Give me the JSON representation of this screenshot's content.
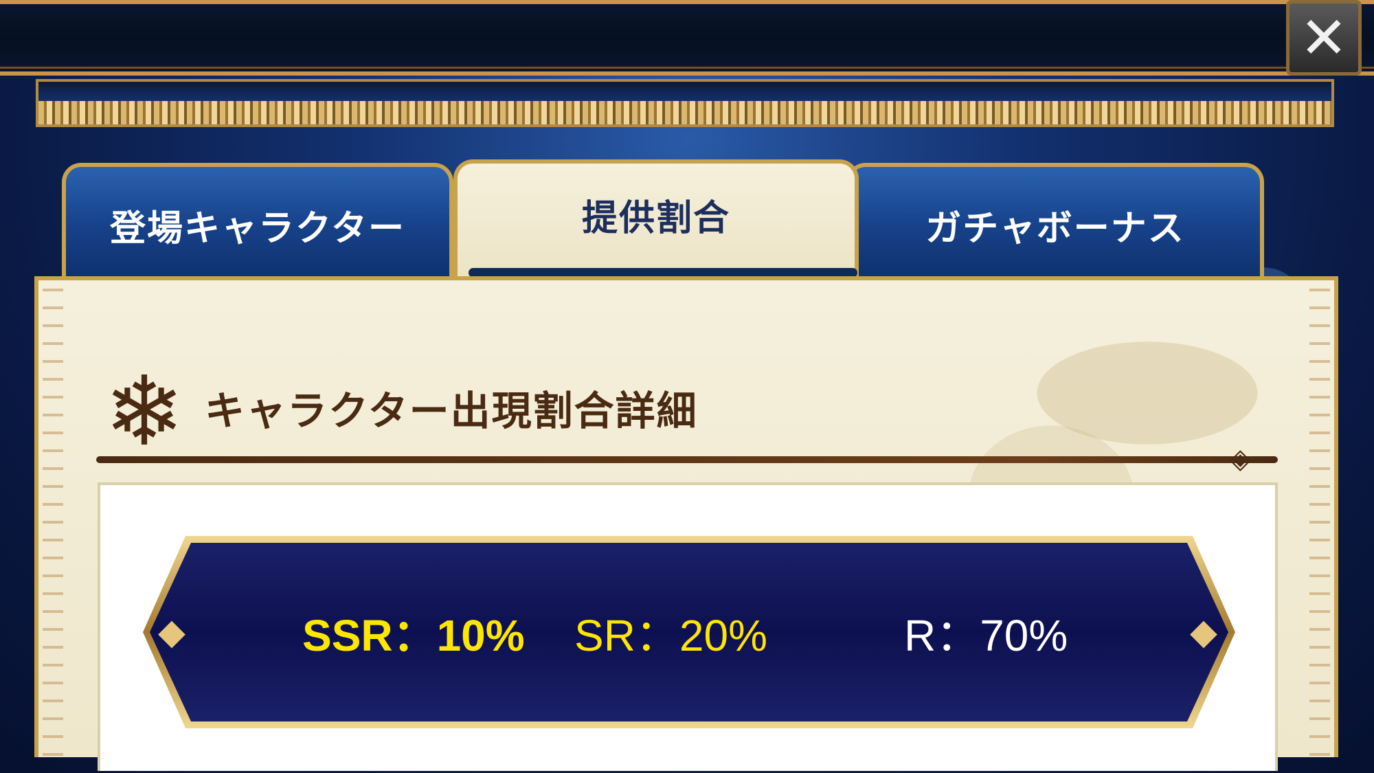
{
  "header": {
    "close_glyph": "✕"
  },
  "tabs": [
    {
      "label": "登場キャラクター",
      "active": false
    },
    {
      "label": "提供割合",
      "active": true
    },
    {
      "label": "ガチャボーナス",
      "active": false
    }
  ],
  "section": {
    "icon": "snowflake-ornament-icon",
    "icon_glyph": "❄",
    "title": "キャラクター出現割合詳細"
  },
  "rates": {
    "ssr": "SSR：10%",
    "sr": "SR：20%",
    "r": "R：70%"
  },
  "colors": {
    "gold": "#c9a24c",
    "rate_yellow": "#ffe600",
    "banner_navy": "#0d1050",
    "title_brown": "#4a2a12"
  }
}
